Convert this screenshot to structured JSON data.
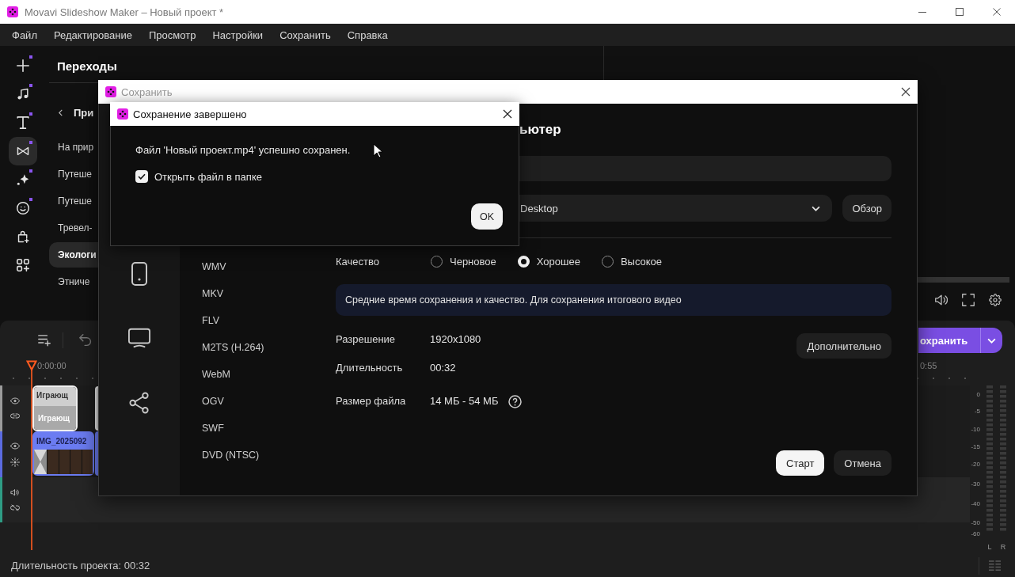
{
  "window": {
    "title": "Movavi Slideshow Maker – Новый проект *",
    "active": false
  },
  "menu": [
    "Файл",
    "Редактирование",
    "Просмотр",
    "Настройки",
    "Сохранить",
    "Справка"
  ],
  "rail": [
    {
      "badge": true,
      "selected": false
    },
    {
      "badge": true,
      "selected": false
    },
    {
      "badge": true,
      "selected": false
    },
    {
      "badge": true,
      "selected": true
    },
    {
      "badge": true,
      "selected": false
    },
    {
      "badge": true,
      "selected": false
    },
    {
      "badge": false,
      "selected": false
    },
    {
      "badge": false,
      "selected": false
    }
  ],
  "transitions_panel": {
    "title": "Переходы",
    "back": "При",
    "items": [
      {
        "label": "На прир",
        "selected": false
      },
      {
        "label": "Путеше",
        "selected": false
      },
      {
        "label": "Путеше",
        "selected": false
      },
      {
        "label": "Тревел-",
        "selected": false
      },
      {
        "label": "Экологи",
        "selected": true
      },
      {
        "label": "Этниче",
        "selected": false
      }
    ]
  },
  "timeline": {
    "save_button": "охранить",
    "ruler": [
      "0:00:00",
      "0:55"
    ],
    "tracks": [
      {
        "kind": "title",
        "color": "#9b9b9b",
        "clip": {
          "top": "Играющ",
          "bottom": "Играющ"
        }
      },
      {
        "kind": "video",
        "color": "#5b6be0",
        "clip": {
          "label": "IMG_2025092"
        }
      },
      {
        "kind": "audio",
        "color": "#2e9c84"
      }
    ],
    "meter": {
      "scale": [
        "0",
        "-5",
        "-10",
        "-15",
        "-20",
        "-30",
        "-40",
        "-50",
        "-60"
      ],
      "channels": [
        "L",
        "R"
      ]
    }
  },
  "status": {
    "duration": "Длительность проекта: 00:32"
  },
  "save_dialog": {
    "title": "Сохранить",
    "active": false,
    "formats": [
      {
        "label": "WMV",
        "selected": false
      },
      {
        "label": "MKV",
        "selected": false
      },
      {
        "label": "FLV",
        "selected": false
      },
      {
        "label": "M2TS (H.264)",
        "selected": false
      },
      {
        "label": "WebM",
        "selected": false
      },
      {
        "label": "OGV",
        "selected": false
      },
      {
        "label": "SWF",
        "selected": false
      },
      {
        "label": "DVD (NTSC)",
        "selected": false
      }
    ],
    "heading": "ьютер",
    "folder": "Desktop",
    "browse": "Обзор",
    "quality": {
      "label": "Качество",
      "options": [
        {
          "label": "Черновое",
          "selected": false
        },
        {
          "label": "Хорошее",
          "selected": true
        },
        {
          "label": "Высокое",
          "selected": false
        }
      ]
    },
    "info": "Средние время сохранения и качество. Для сохранения итогового видео",
    "advanced": "Дополнительно",
    "props": [
      {
        "label": "Разрешение",
        "value": "1920x1080",
        "help": false
      },
      {
        "label": "Длительность",
        "value": "00:32",
        "help": false
      },
      {
        "label": "Размер файла",
        "value": "14 МБ - 54 МБ",
        "help": true
      }
    ],
    "buttons": [
      {
        "label": "Старт",
        "kind": "primary"
      },
      {
        "label": "Отмена",
        "kind": "secondary"
      }
    ]
  },
  "done_dialog": {
    "title": "Сохранение завершено",
    "active": true,
    "message": "Файл 'Новый проект.mp4' успешно сохранен.",
    "open_folder": {
      "label": "Открыть файл в папке",
      "checked": true
    },
    "ok": "OK"
  }
}
